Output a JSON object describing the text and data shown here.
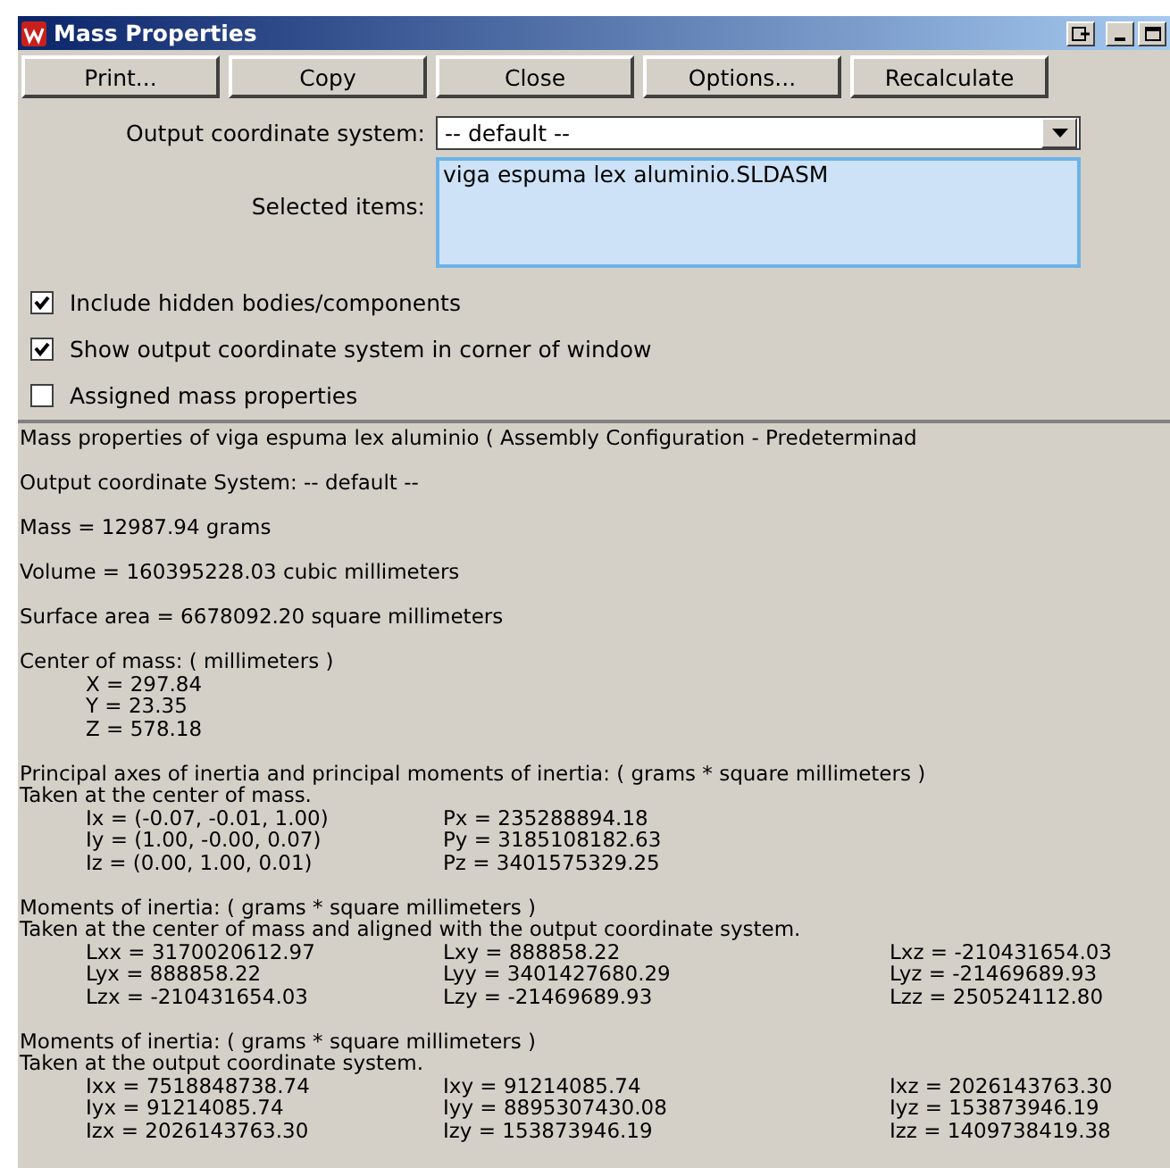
{
  "window": {
    "title": "Mass Properties"
  },
  "buttons": [
    "Print...",
    "Copy",
    "Close",
    "Options...",
    "Recalculate"
  ],
  "coordinate_system": {
    "label": "Output coordinate system:",
    "value": "-- default --"
  },
  "selected_items": {
    "label": "Selected items:",
    "items": [
      "viga espuma lex aluminio.SLDASM"
    ]
  },
  "options": [
    {
      "label": "Include hidden bodies/components",
      "checked": true
    },
    {
      "label": "Show output coordinate system in corner of window",
      "checked": true
    },
    {
      "label": "Assigned mass properties",
      "checked": false
    }
  ],
  "report": [
    {
      "lines": [
        "Mass properties of viga espuma lex aluminio ( Assembly Configuration - Predeterminad"
      ]
    },
    {
      "lines": [
        "Output  coordinate System: -- default --"
      ]
    },
    {
      "lines": [
        "Mass = 12987.94 grams"
      ]
    },
    {
      "lines": [
        "Volume = 160395228.03  cubic millimeters"
      ]
    },
    {
      "lines": [
        "Surface area = 6678092.20  square millimeters"
      ]
    },
    {
      "lines": [
        "Center of mass: ( millimeters )"
      ],
      "rows": [
        [
          "X = 297.84"
        ],
        [
          "Y = 23.35"
        ],
        [
          "Z = 578.18"
        ]
      ]
    },
    {
      "lines": [
        "Principal axes of inertia and principal moments of inertia: ( grams *  square millimeters )",
        "Taken at the center of mass."
      ],
      "rows": [
        [
          "Ix = (-0.07, -0.01, 1.00)",
          "Px = 235288894.18"
        ],
        [
          "Iy = (1.00, -0.00, 0.07)",
          "Py = 3185108182.63"
        ],
        [
          "Iz = (0.00, 1.00, 0.01)",
          "Pz = 3401575329.25"
        ]
      ]
    },
    {
      "lines": [
        "Moments of inertia: ( grams *  square millimeters )",
        "Taken at the center of mass and aligned with the output coordinate system."
      ],
      "rows": [
        [
          "Lxx = 3170020612.97",
          "Lxy = 888858.22",
          "Lxz = -210431654.03"
        ],
        [
          "Lyx = 888858.22",
          "Lyy = 3401427680.29",
          "Lyz = -21469689.93"
        ],
        [
          "Lzx = -210431654.03",
          "Lzy = -21469689.93",
          "Lzz = 250524112.80"
        ]
      ]
    },
    {
      "lines": [
        "Moments of inertia: ( grams *  square millimeters )",
        "Taken at the output coordinate system."
      ],
      "rows": [
        [
          "Ixx = 7518848738.74",
          "Ixy = 91214085.74",
          "Ixz = 2026143763.30"
        ],
        [
          "Iyx = 91214085.74",
          "Iyy = 8895307430.08",
          "Iyz = 153873946.19"
        ],
        [
          "Izx = 2026143763.30",
          "Izy = 153873946.19",
          "Izz = 1409738419.38"
        ]
      ]
    }
  ]
}
